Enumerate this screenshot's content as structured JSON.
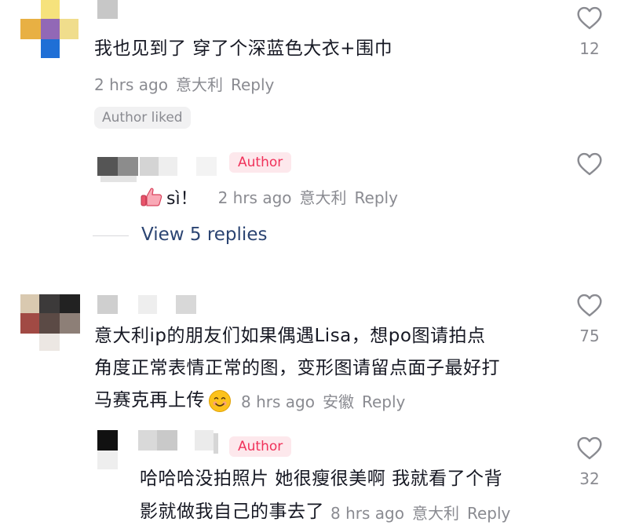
{
  "colors": {
    "author_badge_bg": "#fde8ec",
    "author_badge_text": "#f0325a",
    "meta_gray": "#8a8b91",
    "view_replies_blue": "#2b4472"
  },
  "comments": [
    {
      "text": "我也见到了 穿了个深蓝色大衣+围巾",
      "time": "2 hrs ago",
      "location": "意大利",
      "reply_label": "Reply",
      "badge": "Author liked",
      "likes": "12",
      "reply": {
        "badge": "Author",
        "icon": "thumbs-up-icon",
        "text": "sì！",
        "time": "2 hrs ago",
        "location": "意大利",
        "reply_label": "Reply"
      },
      "view_replies": "View 5 replies"
    },
    {
      "text_lines": [
        "意大利ip的朋友们如果偶遇Lisa，想po图请拍点",
        "角度正常表情正常的图，变形图请留点面子最好打",
        "马赛克再上传"
      ],
      "emoji": "smiling-face-icon",
      "time": "8 hrs ago",
      "location": "安徽",
      "reply_label": "Reply",
      "likes": "75",
      "reply": {
        "badge": "Author",
        "text_lines": [
          "哈哈哈没拍照片 她很瘦很美啊 我就看了个背",
          "影就做我自己的事去了"
        ],
        "time": "8 hrs ago",
        "location": "意大利",
        "reply_label": "Reply",
        "likes": "32"
      }
    }
  ]
}
